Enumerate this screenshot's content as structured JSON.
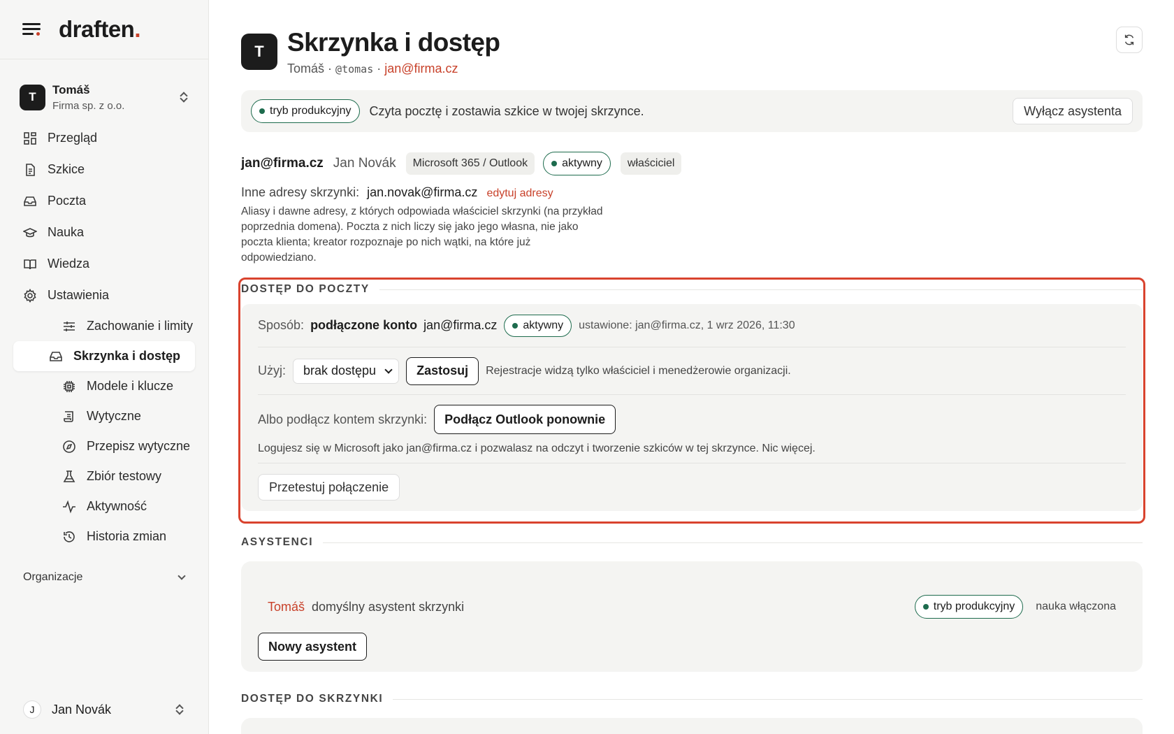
{
  "app": {
    "logo": "draften",
    "logo_dot": ".",
    "accent": "#c8412a",
    "success": "#1d6b4d"
  },
  "account": {
    "initial": "T",
    "name": "Tomáš",
    "org": "Firma sp. z o.o."
  },
  "nav": [
    {
      "label": "Przegląd",
      "icon": "grid-icon"
    },
    {
      "label": "Szkice",
      "icon": "document-icon"
    },
    {
      "label": "Poczta",
      "icon": "inbox-icon"
    },
    {
      "label": "Nauka",
      "icon": "graduation-cap-icon"
    },
    {
      "label": "Wiedza",
      "icon": "book-icon"
    },
    {
      "label": "Ustawienia",
      "icon": "gear-icon"
    }
  ],
  "subnav": [
    {
      "label": "Zachowanie i limity",
      "icon": "sliders-icon"
    },
    {
      "label": "Skrzynka i dostęp",
      "icon": "inbox-icon"
    },
    {
      "label": "Modele i klucze",
      "icon": "chip-icon"
    },
    {
      "label": "Wytyczne",
      "icon": "scroll-icon"
    },
    {
      "label": "Przepisz wytyczne",
      "icon": "compass-icon"
    },
    {
      "label": "Zbiór testowy",
      "icon": "flask-icon"
    },
    {
      "label": "Aktywność",
      "icon": "activity-icon"
    },
    {
      "label": "Historia zmian",
      "icon": "history-icon"
    }
  ],
  "org_section": "Organizacje",
  "user": {
    "initial": "J",
    "name": "Jan Novák"
  },
  "header": {
    "initial": "T",
    "title": "Skrzynka i dostęp",
    "name": "Tomáš",
    "sep": "·",
    "handle": "@tomas",
    "email": "jan@firma.cz"
  },
  "mode_bar": {
    "badge": "tryb produkcyjny",
    "text": "Czyta pocztę i zostawia szkice w twojej skrzynce.",
    "button": "Wyłącz asystenta"
  },
  "mailbox": {
    "email": "jan@firma.cz",
    "owner": "Jan Novák",
    "provider": "Microsoft 365 / Outlook",
    "status": "aktywny",
    "role": "właściciel",
    "aliases_label": "Inne adresy skrzynki:",
    "aliases_value": "jan.novak@firma.cz",
    "aliases_edit": "edytuj adresy",
    "aliases_desc": "Aliasy i dawne adresy, z których odpowiada właściciel skrzynki (na przykład poprzednia domena). Poczta z nich liczy się jako jego własna, nie jako poczta klienta; kreator rozpoznaje po nich wątki, na które już odpowiedziano."
  },
  "mail_access": {
    "title": "DOSTĘP DO POCZTY",
    "method_label": "Sposób:",
    "method_value": "podłączone konto",
    "method_email": "jan@firma.cz",
    "method_status": "aktywny",
    "method_meta": "ustawione: jan@firma.cz, 1 wrz 2026, 11:30",
    "use_label": "Użyj:",
    "use_select": "brak dostępu",
    "apply_button": "Zastosuj",
    "use_note": "Rejestracje widzą tylko właściciel i menedżerowie organizacji.",
    "connect_label": "Albo podłącz kontem skrzynki:",
    "connect_button": "Podłącz Outlook ponownie",
    "connect_note": "Logujesz się w Microsoft jako jan@firma.cz i pozwalasz na odczyt i tworzenie szkiców w tej skrzynce. Nic więcej.",
    "test_button": "Przetestuj połączenie"
  },
  "assistants": {
    "title": "ASYSTENCI",
    "name": "Tomáš",
    "desc": "domyślny asystent skrzynki",
    "badge": "tryb produkcyjny",
    "learning": "nauka włączona",
    "new_button": "Nowy asystent"
  },
  "mailbox_access": {
    "title": "DOSTĘP DO SKRZYNKI"
  }
}
